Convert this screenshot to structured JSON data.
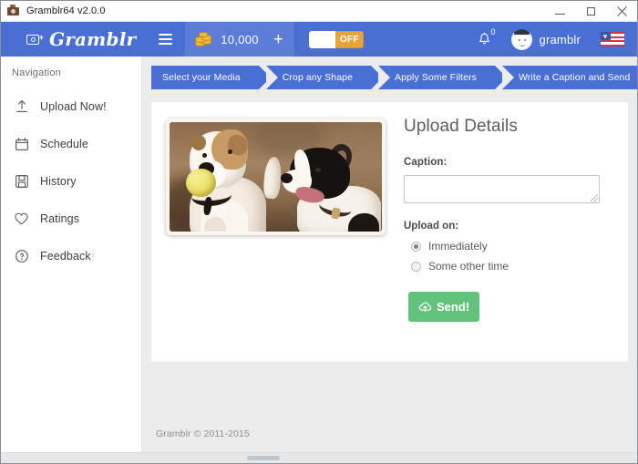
{
  "window": {
    "title": "Gramblr64 v2.0.0",
    "icon": "app-camera-icon",
    "controls": {
      "minimize": "minimize-icon",
      "maximize": "maximize-icon",
      "close": "close-icon"
    }
  },
  "appbar": {
    "logo_text": "Gramblr",
    "menu_icon": "hamburger-menu-icon",
    "coins": {
      "icon": "coin-stack-icon",
      "value": "10,000",
      "add_label": "+"
    },
    "toggle": {
      "label": "OFF",
      "state": "off"
    },
    "notifications": {
      "icon": "bell-icon",
      "count": "0"
    },
    "username": "gramblr",
    "avatar": "user-avatar",
    "language_flag": "us-flag-icon"
  },
  "sidebar": {
    "title": "Navigation",
    "items": [
      {
        "label": "Upload Now!",
        "icon": "upload-arrow-icon"
      },
      {
        "label": "Schedule",
        "icon": "calendar-icon"
      },
      {
        "label": "History",
        "icon": "save-disk-icon"
      },
      {
        "label": "Ratings",
        "icon": "heart-icon"
      },
      {
        "label": "Feedback",
        "icon": "question-circle-icon"
      }
    ]
  },
  "steps": [
    {
      "label": "Select your Media"
    },
    {
      "label": "Crop any Shape"
    },
    {
      "label": "Apply Some Filters"
    },
    {
      "label": "Write a Caption and Send"
    }
  ],
  "preview": {
    "alt": "two-jack-russell-terriers-one-holding-yellow-tennis-ball"
  },
  "details": {
    "title": "Upload Details",
    "caption_label": "Caption:",
    "caption_value": "",
    "caption_placeholder": "",
    "upload_on_label": "Upload on:",
    "options": [
      {
        "label": "Immediately",
        "selected": true
      },
      {
        "label": "Some other time",
        "selected": false
      }
    ],
    "send_label": "Send!",
    "send_icon": "cloud-upload-icon",
    "send_color": "#63c37c"
  },
  "footer": {
    "text": "Gramblr © 2011-2015"
  },
  "colors": {
    "appbar_blue": "#4a6fd4",
    "coins_blue": "#5b7dd8",
    "toggle_orange": "#e8a33d",
    "send_green": "#63c37c",
    "page_gray": "#ececec"
  }
}
